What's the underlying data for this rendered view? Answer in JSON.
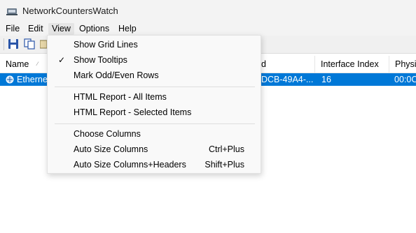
{
  "window": {
    "title": "NetworkCountersWatch"
  },
  "menubar": {
    "items": [
      {
        "label": "File"
      },
      {
        "label": "Edit"
      },
      {
        "label": "View"
      },
      {
        "label": "Options"
      },
      {
        "label": "Help"
      }
    ],
    "active": "View"
  },
  "toolbar": {
    "buttons": [
      {
        "icon": "save-icon"
      },
      {
        "icon": "copy-icon"
      },
      {
        "icon": "properties-icon"
      }
    ]
  },
  "table": {
    "columns": [
      {
        "label": "Name"
      },
      {
        "label": "d"
      },
      {
        "label": "Interface Index"
      },
      {
        "label": "Physic"
      }
    ],
    "rows": [
      {
        "name": "Ethernet",
        "id": "DCB-49A4-...",
        "interface_index": "16",
        "physical": "00:0C:",
        "selected": true
      }
    ]
  },
  "view_menu": {
    "items": [
      {
        "label": "Show Grid Lines",
        "checked": false,
        "shortcut": ""
      },
      {
        "label": "Show Tooltips",
        "checked": true,
        "shortcut": ""
      },
      {
        "label": "Mark Odd/Even Rows",
        "checked": false,
        "shortcut": ""
      },
      {
        "label": "HTML Report - All Items",
        "checked": false,
        "shortcut": ""
      },
      {
        "label": "HTML Report - Selected Items",
        "checked": false,
        "shortcut": ""
      },
      {
        "label": "Choose Columns",
        "checked": false,
        "shortcut": ""
      },
      {
        "label": "Auto Size Columns",
        "checked": false,
        "shortcut": "Ctrl+Plus"
      },
      {
        "label": "Auto Size Columns+Headers",
        "checked": false,
        "shortcut": "Shift+Plus"
      }
    ]
  },
  "colors": {
    "selection": "#0078d7",
    "menu_bg": "#f9f9f9",
    "chrome_bg": "#f3f3f3"
  }
}
